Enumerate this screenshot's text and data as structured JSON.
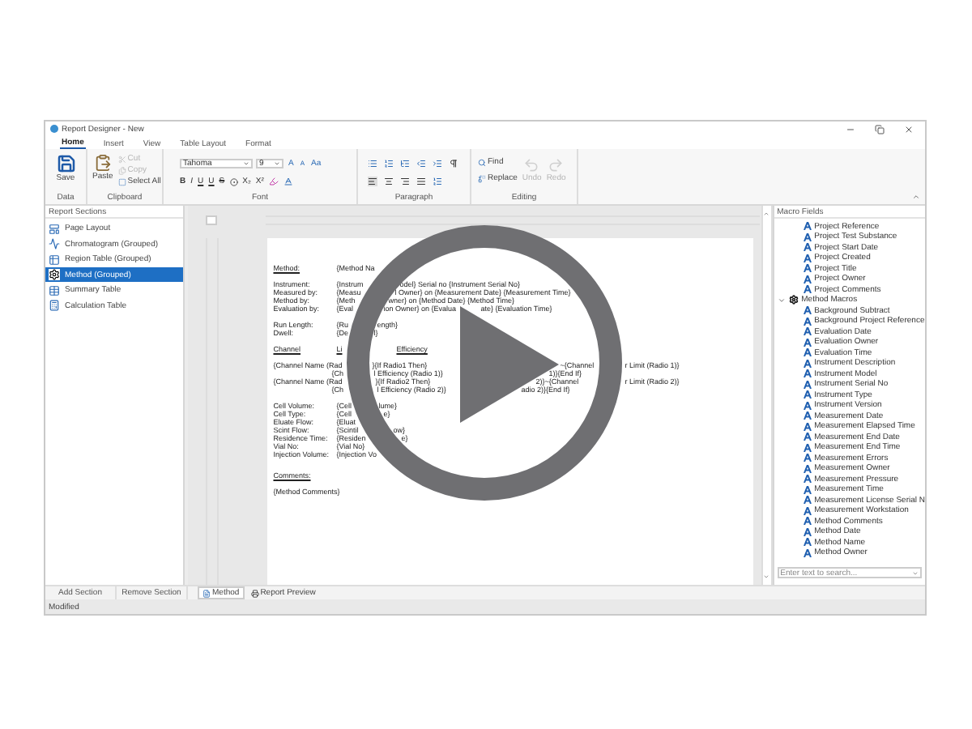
{
  "window": {
    "title": "Report Designer - New"
  },
  "ribbon_tabs": [
    {
      "label": "Home",
      "selected": true
    },
    {
      "label": "Insert",
      "selected": false
    },
    {
      "label": "View",
      "selected": false
    },
    {
      "label": "Table Layout",
      "selected": false
    },
    {
      "label": "Format",
      "selected": false
    }
  ],
  "ribbon": {
    "data": {
      "label": "Data",
      "save": "Save"
    },
    "clipboard": {
      "label": "Clipboard",
      "paste": "Paste",
      "cut": {
        "label": "Cut",
        "disabled": true
      },
      "copy": {
        "label": "Copy",
        "disabled": true
      },
      "select_all": {
        "label": "Select All",
        "disabled": false
      }
    },
    "font": {
      "label": "Font",
      "font_name": "Tahoma",
      "font_size": "9",
      "size_buttons": [
        "A",
        "A",
        "Aa"
      ],
      "style_buttons": [
        "B",
        "I",
        "U",
        "U",
        "S"
      ],
      "script_buttons": [
        "X₂",
        "X²"
      ]
    },
    "paragraph": {
      "label": "Paragraph"
    },
    "editing": {
      "label": "Editing",
      "find": "Find",
      "replace": "Replace",
      "undo": {
        "label": "Undo",
        "disabled": true
      },
      "redo": {
        "label": "Redo",
        "disabled": true
      }
    }
  },
  "report_sections": {
    "title": "Report Sections",
    "items": [
      {
        "label": "Page Layout",
        "selected": false
      },
      {
        "label": "Chromatogram (Grouped)",
        "selected": false
      },
      {
        "label": "Region Table (Grouped)",
        "selected": false
      },
      {
        "label": "Method (Grouped)",
        "selected": true
      },
      {
        "label": "Summary Table",
        "selected": false
      },
      {
        "label": "Calculation Table",
        "selected": false
      }
    ],
    "buttons": [
      "Add Section",
      "Remove Section"
    ]
  },
  "document": {
    "lines": [
      {
        "segments": [
          {
            "text": "Method:",
            "underlined": true
          },
          {
            "text": "{Method Na",
            "underlined": false
          }
        ]
      },
      {
        "segments": [
          {
            "text": "Instrument:",
            "underlined": false
          },
          {
            "text": "{Instrum",
            "underlined": false
          },
          {
            "text": "odel} Serial no {Instrument Serial No}",
            "underlined": false
          }
        ]
      },
      {
        "segments": [
          {
            "text": "Measured by:",
            "underlined": false
          },
          {
            "text": "{Measu",
            "underlined": false
          },
          {
            "text": "l Owner} on {Measurement Date} {Measurement Time}",
            "underlined": false
          }
        ]
      },
      {
        "segments": [
          {
            "text": "Method by:",
            "underlined": false
          },
          {
            "text": "{Meth",
            "underlined": false
          },
          {
            "text": "wner} on {Method Date} {Method Time}",
            "underlined": false
          }
        ]
      },
      {
        "segments": [
          {
            "text": "Evaluation by:",
            "underlined": false
          },
          {
            "text": "{Eval",
            "underlined": false
          },
          {
            "text": "ion Owner} on {Evalua",
            "underlined": false
          },
          {
            "text": "ate} {Evaluation Time}",
            "underlined": false
          }
        ]
      },
      {
        "segments": [
          {
            "text": "Run Length:",
            "underlined": false
          },
          {
            "text": "{Ru",
            "underlined": false
          },
          {
            "text": "ength}",
            "underlined": false
          }
        ]
      },
      {
        "segments": [
          {
            "text": "Dwell:",
            "underlined": false
          },
          {
            "text": "{De",
            "underlined": false
          },
          {
            "text": "l}",
            "underlined": false
          }
        ]
      },
      {
        "segments": [
          {
            "text": "Channel",
            "underlined": true
          },
          {
            "text": "Li",
            "underlined": true
          },
          {
            "text": "Efficiency",
            "underlined": true
          }
        ]
      },
      {
        "segments": [
          {
            "text": "{Channel Name (Rad",
            "underlined": false
          },
          {
            "text": "}{If Radio1 Then}",
            "underlined": false
          },
          {
            "text": "~{Channel",
            "underlined": false
          },
          {
            "text": "r Limit (Radio 1)}",
            "underlined": false
          }
        ]
      },
      {
        "segments": [
          {
            "text": "{Ch",
            "underlined": false
          },
          {
            "text": "l Efficiency (Radio 1)}",
            "underlined": false
          },
          {
            "text": "1)}{End If}",
            "underlined": false
          }
        ]
      },
      {
        "segments": [
          {
            "text": "{Channel Name (Rad",
            "underlined": false
          },
          {
            "text": "}{If Radio2 Then}",
            "underlined": false
          },
          {
            "text": "2)}~{Channel",
            "underlined": false
          },
          {
            "text": "r Limit (Radio 2)}",
            "underlined": false
          }
        ]
      },
      {
        "segments": [
          {
            "text": "{Ch",
            "underlined": false
          },
          {
            "text": "l Efficiency (Radio 2)}",
            "underlined": false
          },
          {
            "text": "adio 2)}{End If}",
            "underlined": false
          }
        ]
      },
      {
        "segments": [
          {
            "text": "Cell Volume:",
            "underlined": false
          },
          {
            "text": "{Cell",
            "underlined": false
          },
          {
            "text": "lume}",
            "underlined": false
          }
        ]
      },
      {
        "segments": [
          {
            "text": "Cell Type:",
            "underlined": false
          },
          {
            "text": "{Cell",
            "underlined": false
          },
          {
            "text": "e}",
            "underlined": false
          }
        ]
      },
      {
        "segments": [
          {
            "text": "Eluate Flow:",
            "underlined": false
          },
          {
            "text": "{Eluat",
            "underlined": false
          }
        ]
      },
      {
        "segments": [
          {
            "text": "Scint Flow:",
            "underlined": false
          },
          {
            "text": "{Scintil",
            "underlined": false
          },
          {
            "text": "ow}",
            "underlined": false
          }
        ]
      },
      {
        "segments": [
          {
            "text": "Residence Time:",
            "underlined": false
          },
          {
            "text": "{Residen",
            "underlined": false
          },
          {
            "text": "e}",
            "underlined": false
          }
        ]
      },
      {
        "segments": [
          {
            "text": "Vial No:",
            "underlined": false
          },
          {
            "text": "{Vial No}",
            "underlined": false
          }
        ]
      },
      {
        "segments": [
          {
            "text": "Injection Volume:",
            "underlined": false
          },
          {
            "text": "{Injection Vo",
            "underlined": false
          }
        ]
      },
      {
        "segments": [
          {
            "text": "Comments:",
            "underlined": true
          }
        ]
      },
      {
        "segments": [
          {
            "text": "{Method Comments}",
            "underlined": false
          }
        ]
      }
    ]
  },
  "view_tabs": [
    {
      "label": "Method",
      "selected": true
    },
    {
      "label": "Report Preview",
      "selected": false
    }
  ],
  "macro_fields": {
    "title": "Macro Fields",
    "items": [
      {
        "kind": "field",
        "label": "Project Reference"
      },
      {
        "kind": "field",
        "label": "Project Test Substance"
      },
      {
        "kind": "field",
        "label": "Project Start Date"
      },
      {
        "kind": "field",
        "label": "Project Created"
      },
      {
        "kind": "field",
        "label": "Project Title"
      },
      {
        "kind": "field",
        "label": "Project Owner"
      },
      {
        "kind": "field",
        "label": "Project Comments"
      },
      {
        "kind": "group",
        "label": "Method Macros",
        "expanded": true,
        "children": [
          {
            "kind": "field",
            "label": "Background Subtract"
          },
          {
            "kind": "field",
            "label": "Background Project Reference"
          },
          {
            "kind": "field",
            "label": "Evaluation Date"
          },
          {
            "kind": "field",
            "label": "Evaluation Owner"
          },
          {
            "kind": "field",
            "label": "Evaluation Time"
          },
          {
            "kind": "field",
            "label": "Instrument Description"
          },
          {
            "kind": "field",
            "label": "Instrument Model"
          },
          {
            "kind": "field",
            "label": "Instrument Serial No"
          },
          {
            "kind": "field",
            "label": "Instrument Type"
          },
          {
            "kind": "field",
            "label": "Instrument Version"
          },
          {
            "kind": "field",
            "label": "Measurement Date"
          },
          {
            "kind": "field",
            "label": "Measurement Elapsed Time"
          },
          {
            "kind": "field",
            "label": "Measurement End Date"
          },
          {
            "kind": "field",
            "label": "Measurement End Time"
          },
          {
            "kind": "field",
            "label": "Measurement Errors"
          },
          {
            "kind": "field",
            "label": "Measurement Owner"
          },
          {
            "kind": "field",
            "label": "Measurement Pressure"
          },
          {
            "kind": "field",
            "label": "Measurement Time"
          },
          {
            "kind": "field",
            "label": "Measurement License Serial N"
          },
          {
            "kind": "field",
            "label": "Measurement Workstation"
          },
          {
            "kind": "field",
            "label": "Method Comments"
          },
          {
            "kind": "field",
            "label": "Method Date"
          },
          {
            "kind": "field",
            "label": "Method Name"
          },
          {
            "kind": "field",
            "label": "Method Owner"
          }
        ]
      }
    ],
    "search": {
      "placeholder": "Enter text to search..."
    }
  },
  "status_bar": {
    "text": "Modified"
  }
}
